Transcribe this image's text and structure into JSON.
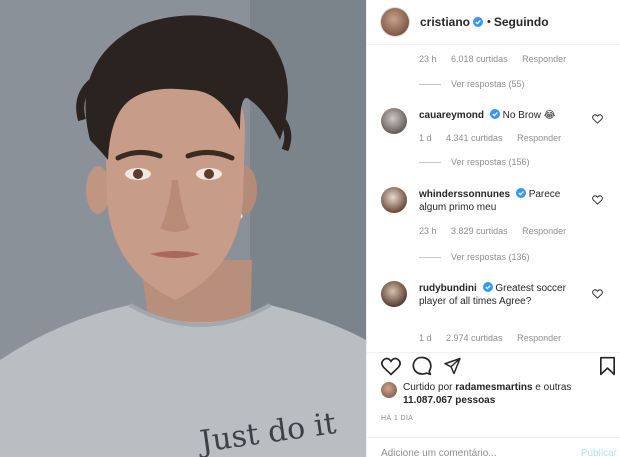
{
  "post": {
    "username": "cristiano",
    "separator": "•",
    "follow_status": "Seguindo",
    "shirt_text": "Just do it"
  },
  "first_comment_meta": {
    "time": "23 h",
    "likes": "6.018 curtidas",
    "reply": "Responder"
  },
  "first_comment_replies": "Ver respostas (55)",
  "comments": [
    {
      "username": "cauareymond",
      "text": "No Brow 😂",
      "time": "1 d",
      "likes": "4.341 curtidas",
      "reply": "Responder",
      "replies": "Ver respostas (156)"
    },
    {
      "username": "whinderssonnunes",
      "text": "Parece algum primo meu",
      "time": "23 h",
      "likes": "3.829 curtidas",
      "reply": "Responder",
      "replies": "Ver respostas (136)"
    },
    {
      "username": "rudybundini",
      "text": "Greatest soccer player of all times Agree?",
      "time": "1 d",
      "likes": "2.974 curtidas",
      "reply": "Responder"
    }
  ],
  "liked_by": {
    "prefix": "Curtido por",
    "user": "radamesmartins",
    "connector": "e outras",
    "count": "11.087.067 pessoas"
  },
  "timestamp": "HÁ 1 DIA",
  "add_comment": {
    "placeholder": "Adicione um comentário...",
    "post_label": "Publicar"
  },
  "colors": {
    "verified": "#3897f0",
    "muted": "#8e8e8e",
    "post_disabled": "#b2dffc"
  },
  "icons": [
    "heart-icon",
    "comment-icon",
    "share-icon",
    "bookmark-icon",
    "verified-icon"
  ]
}
